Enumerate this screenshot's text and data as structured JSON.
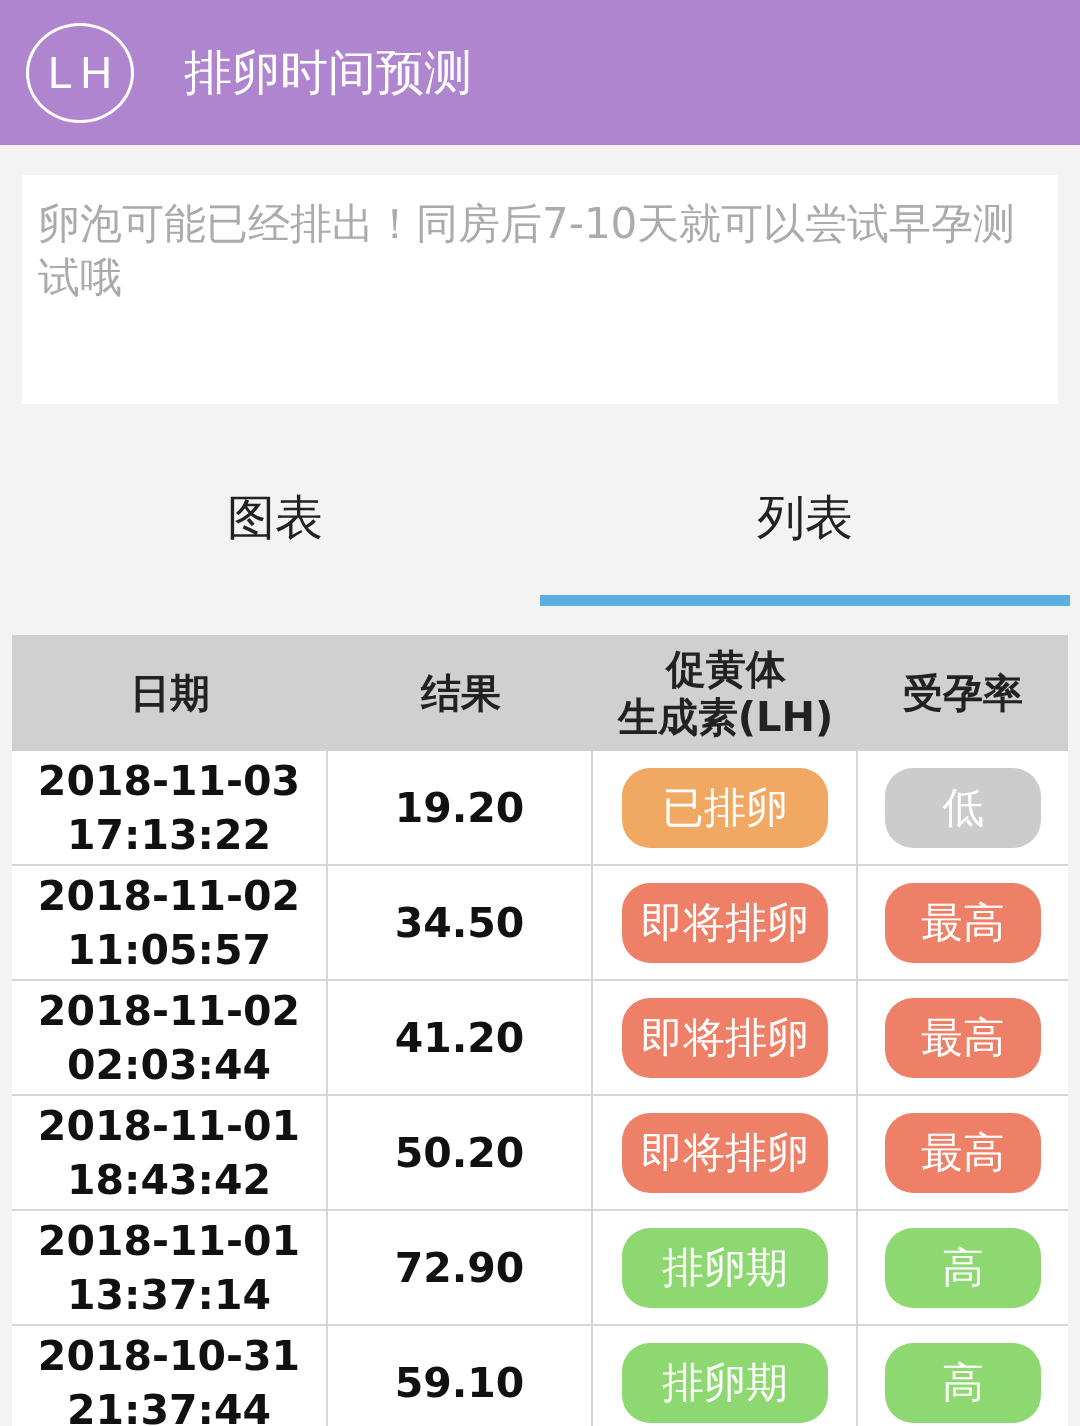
{
  "header": {
    "logo": "LH",
    "title": "排卵时间预测"
  },
  "message": {
    "placeholder": "卵泡可能已经排出！同房后7-10天就可以尝试早孕测试哦"
  },
  "tabs": [
    {
      "label": "图表",
      "selected": false
    },
    {
      "label": "列表",
      "selected": true
    }
  ],
  "table": {
    "columns": [
      {
        "lines": [
          "日期"
        ]
      },
      {
        "lines": [
          "结果"
        ]
      },
      {
        "lines": [
          "促黄体",
          "生成素(LH)"
        ]
      },
      {
        "lines": [
          "受孕率"
        ]
      }
    ],
    "rows": [
      {
        "date": "2018-11-03",
        "time": "17:13:22",
        "result": "19.20",
        "lh": {
          "text": "已排卵",
          "color": "#f0a862"
        },
        "rate": {
          "text": "低",
          "color": "#cccccc"
        }
      },
      {
        "date": "2018-11-02",
        "time": "11:05:57",
        "result": "34.50",
        "lh": {
          "text": "即将排卵",
          "color": "#ee8068"
        },
        "rate": {
          "text": "最高",
          "color": "#ee8068"
        }
      },
      {
        "date": "2018-11-02",
        "time": "02:03:44",
        "result": "41.20",
        "lh": {
          "text": "即将排卵",
          "color": "#ee8068"
        },
        "rate": {
          "text": "最高",
          "color": "#ee8068"
        }
      },
      {
        "date": "2018-11-01",
        "time": "18:43:42",
        "result": "50.20",
        "lh": {
          "text": "即将排卵",
          "color": "#ee8068"
        },
        "rate": {
          "text": "最高",
          "color": "#ee8068"
        }
      },
      {
        "date": "2018-11-01",
        "time": "13:37:14",
        "result": "72.90",
        "lh": {
          "text": "排卵期",
          "color": "#8ed872"
        },
        "rate": {
          "text": "高",
          "color": "#8ed872"
        }
      },
      {
        "date": "2018-10-31",
        "time": "21:37:44",
        "result": "59.10",
        "lh": {
          "text": "排卵期",
          "color": "#8ed872"
        },
        "rate": {
          "text": "高",
          "color": "#8ed872"
        }
      }
    ]
  }
}
